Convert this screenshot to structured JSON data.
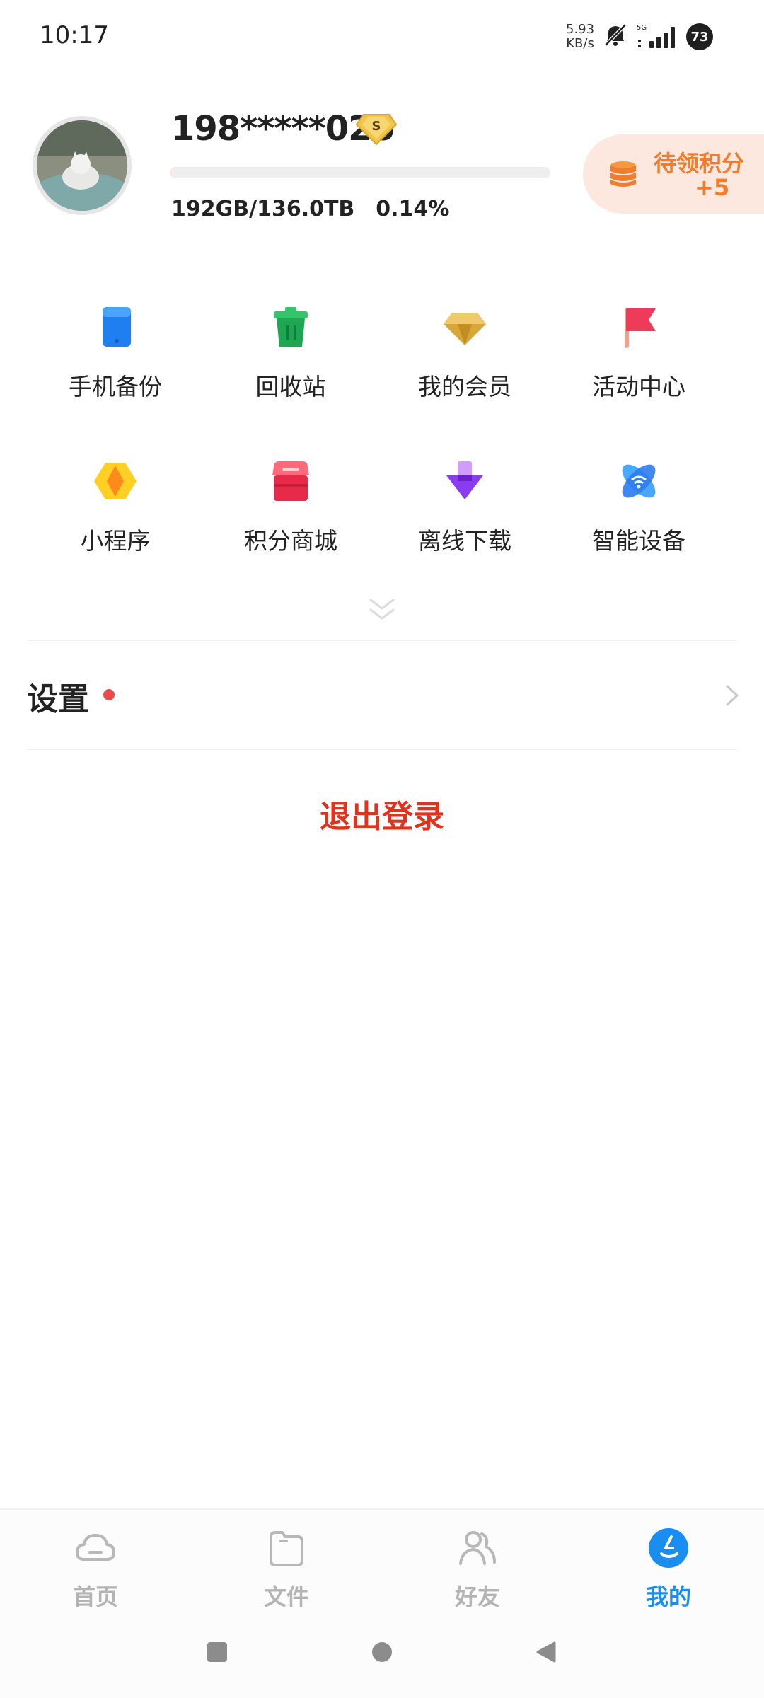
{
  "status_bar": {
    "time": "10:17",
    "net_speed_value": "5.93",
    "net_speed_unit": "KB/s",
    "network_type": "5G",
    "battery": "73"
  },
  "profile": {
    "username": "198*****026",
    "vip_level": "S",
    "storage_used": "192GB/136.0TB",
    "storage_percent": "0.14%",
    "storage_fraction": 0.0014,
    "points_label": "待领积分",
    "points_value": "+5"
  },
  "grid": {
    "items": [
      {
        "label": "手机备份",
        "icon": "phone-backup-icon"
      },
      {
        "label": "回收站",
        "icon": "recycle-bin-icon"
      },
      {
        "label": "我的会员",
        "icon": "membership-diamond-icon"
      },
      {
        "label": "活动中心",
        "icon": "activity-flag-icon"
      },
      {
        "label": "小程序",
        "icon": "mini-program-icon"
      },
      {
        "label": "积分商城",
        "icon": "points-store-icon"
      },
      {
        "label": "离线下载",
        "icon": "offline-download-icon"
      },
      {
        "label": "智能设备",
        "icon": "smart-device-icon"
      }
    ]
  },
  "settings": {
    "label": "设置"
  },
  "logout": {
    "label": "退出登录"
  },
  "bottom_nav": {
    "items": [
      {
        "label": "首页",
        "icon": "cloud-home-icon",
        "active": false
      },
      {
        "label": "文件",
        "icon": "folder-icon",
        "active": false
      },
      {
        "label": "好友",
        "icon": "friends-icon",
        "active": false
      },
      {
        "label": "我的",
        "icon": "profile-icon",
        "active": true
      }
    ]
  },
  "colors": {
    "accent": "#1a8ef0",
    "logout": "#e0321c",
    "points": "#ef7d2d",
    "badge_dot": "#ee4a4a"
  }
}
